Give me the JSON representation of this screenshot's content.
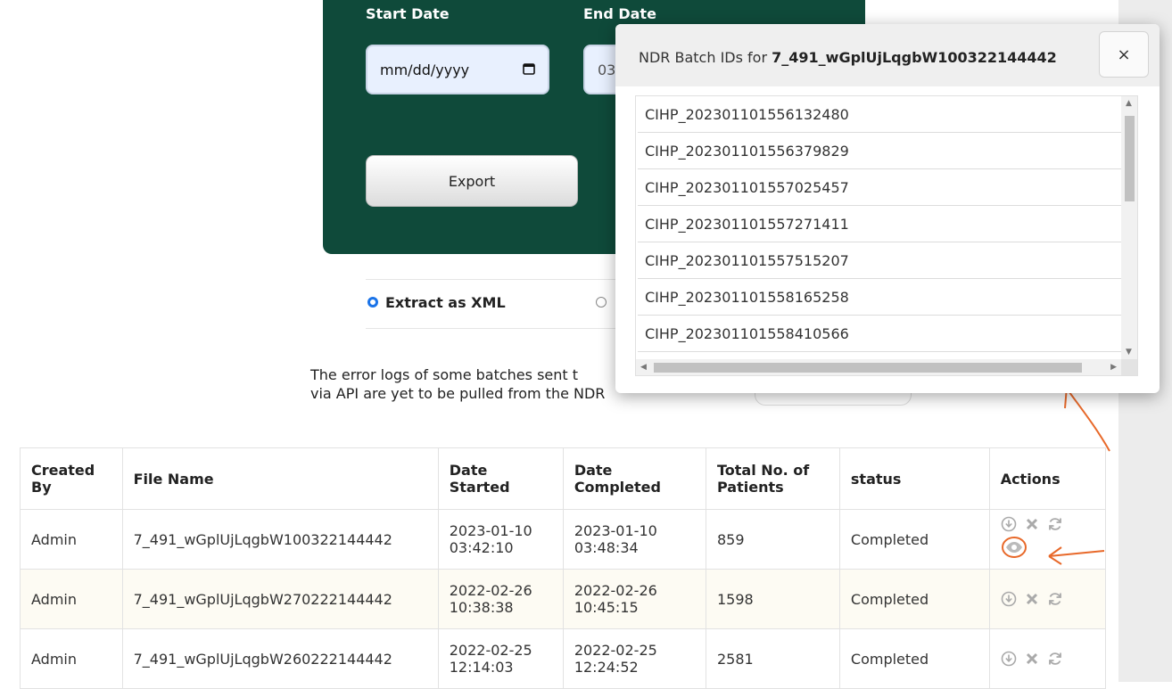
{
  "export_form": {
    "start_label": "Start Date",
    "end_label": "End Date",
    "start_value": "mm/dd/yyyy",
    "end_value": "03",
    "export_label": "Export"
  },
  "options": {
    "xml_label": "Extract as XML"
  },
  "error_note": {
    "line1": "The error logs of some batches sent t",
    "line2": "via API are yet to be pulled from the NDR"
  },
  "table": {
    "headers": [
      "Created By",
      "File Name",
      "Date Started",
      "Date Completed",
      "Total No. of Patients",
      "status",
      "Actions"
    ],
    "rows": [
      {
        "created_by": "Admin",
        "file": "7_491_wGplUjLqgbW100322144442",
        "started": "2023-01-10 03:42:10",
        "completed": "2023-01-10 03:48:34",
        "patients": "859",
        "status": "Completed"
      },
      {
        "created_by": "Admin",
        "file": "7_491_wGplUjLqgbW270222144442",
        "started": "2022-02-26 10:38:38",
        "completed": "2022-02-26 10:45:15",
        "patients": "1598",
        "status": "Completed"
      },
      {
        "created_by": "Admin",
        "file": "7_491_wGplUjLqgbW260222144442",
        "started": "2022-02-25 12:14:03",
        "completed": "2022-02-25 12:24:52",
        "patients": "2581",
        "status": "Completed"
      }
    ]
  },
  "modal": {
    "title_prefix": "NDR Batch IDs for ",
    "title_bold": "7_491_wGplUjLqgbW100322144442",
    "close": "×",
    "batch_ids": [
      "CIHP_202301101556132480",
      "CIHP_202301101556379829",
      "CIHP_202301101557025457",
      "CIHP_202301101557271411",
      "CIHP_202301101557515207",
      "CIHP_202301101558165258",
      "CIHP_202301101558410566"
    ]
  },
  "colors": {
    "panel": "#0f4a3a",
    "annotation": "#e8692a",
    "radio_selected": "#1a73e8"
  },
  "icons": [
    "calendar-icon",
    "download-icon",
    "delete-icon",
    "refresh-icon",
    "eye-icon"
  ]
}
